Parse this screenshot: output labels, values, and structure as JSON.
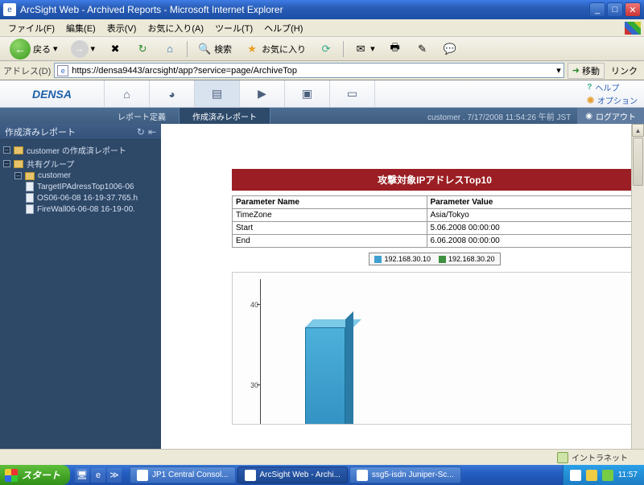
{
  "window": {
    "title": "ArcSight Web - Archived Reports - Microsoft Internet Explorer"
  },
  "menubar": [
    "ファイル(F)",
    "編集(E)",
    "表示(V)",
    "お気に入り(A)",
    "ツール(T)",
    "ヘルプ(H)"
  ],
  "toolbar": {
    "back": "戻る",
    "search": "検索",
    "favorites": "お気に入り"
  },
  "addressbar": {
    "label": "アドレス(D)",
    "url": "https://densa9443/arcsight/app?service=page/ArchiveTop",
    "go": "移動",
    "links": "リンク"
  },
  "app": {
    "logo": "DENSA",
    "help": "ヘルプ",
    "option": "オプション",
    "subnav": {
      "report_def": "レポート定義",
      "archived": "作成済みレポート"
    },
    "status": "customer . 7/17/2008 11:54:26 午前 JST",
    "logout": "ログアウト"
  },
  "sidebar": {
    "header": "作成済みレポート",
    "nodes": {
      "n0": "customer の作成済レポート",
      "n1": "共有グループ",
      "n2": "customer",
      "n3": "TargetIPAdressTop1006-06",
      "n4": "OS06-06-08 16-19-37.765.h",
      "n5": "FireWall06-06-08 16-19-00."
    }
  },
  "report": {
    "title": "攻撃対象IPアドレスTop10",
    "param_name_hdr": "Parameter Name",
    "param_value_hdr": "Parameter Value",
    "params": [
      {
        "name": "TimeZone",
        "value": "Asia/Tokyo"
      },
      {
        "name": "Start",
        "value": "5.06.2008 00:00:00"
      },
      {
        "name": "End",
        "value": "6.06.2008 00:00:00"
      }
    ],
    "legend": [
      {
        "color": "#3fa0d0",
        "label": "192.168.30.10"
      },
      {
        "color": "#3f9040",
        "label": "192.168.30.20"
      }
    ]
  },
  "chart_data": {
    "type": "bar",
    "title": "攻撃対象IPアドレスTop10",
    "xlabel": "",
    "ylabel": "",
    "ylim": [
      30,
      45
    ],
    "y_ticks": [
      30,
      40
    ],
    "series": [
      {
        "name": "192.168.30.10",
        "color": "#3fa0d0",
        "value": 37
      }
    ]
  },
  "statusbar": {
    "zone": "イントラネット"
  },
  "taskbar": {
    "start": "スタート",
    "tasks": [
      "JP1 Central Consol...",
      "ArcSight Web - Archi...",
      "ssg5-isdn Juniper-Sc..."
    ],
    "clock": "11:57"
  }
}
